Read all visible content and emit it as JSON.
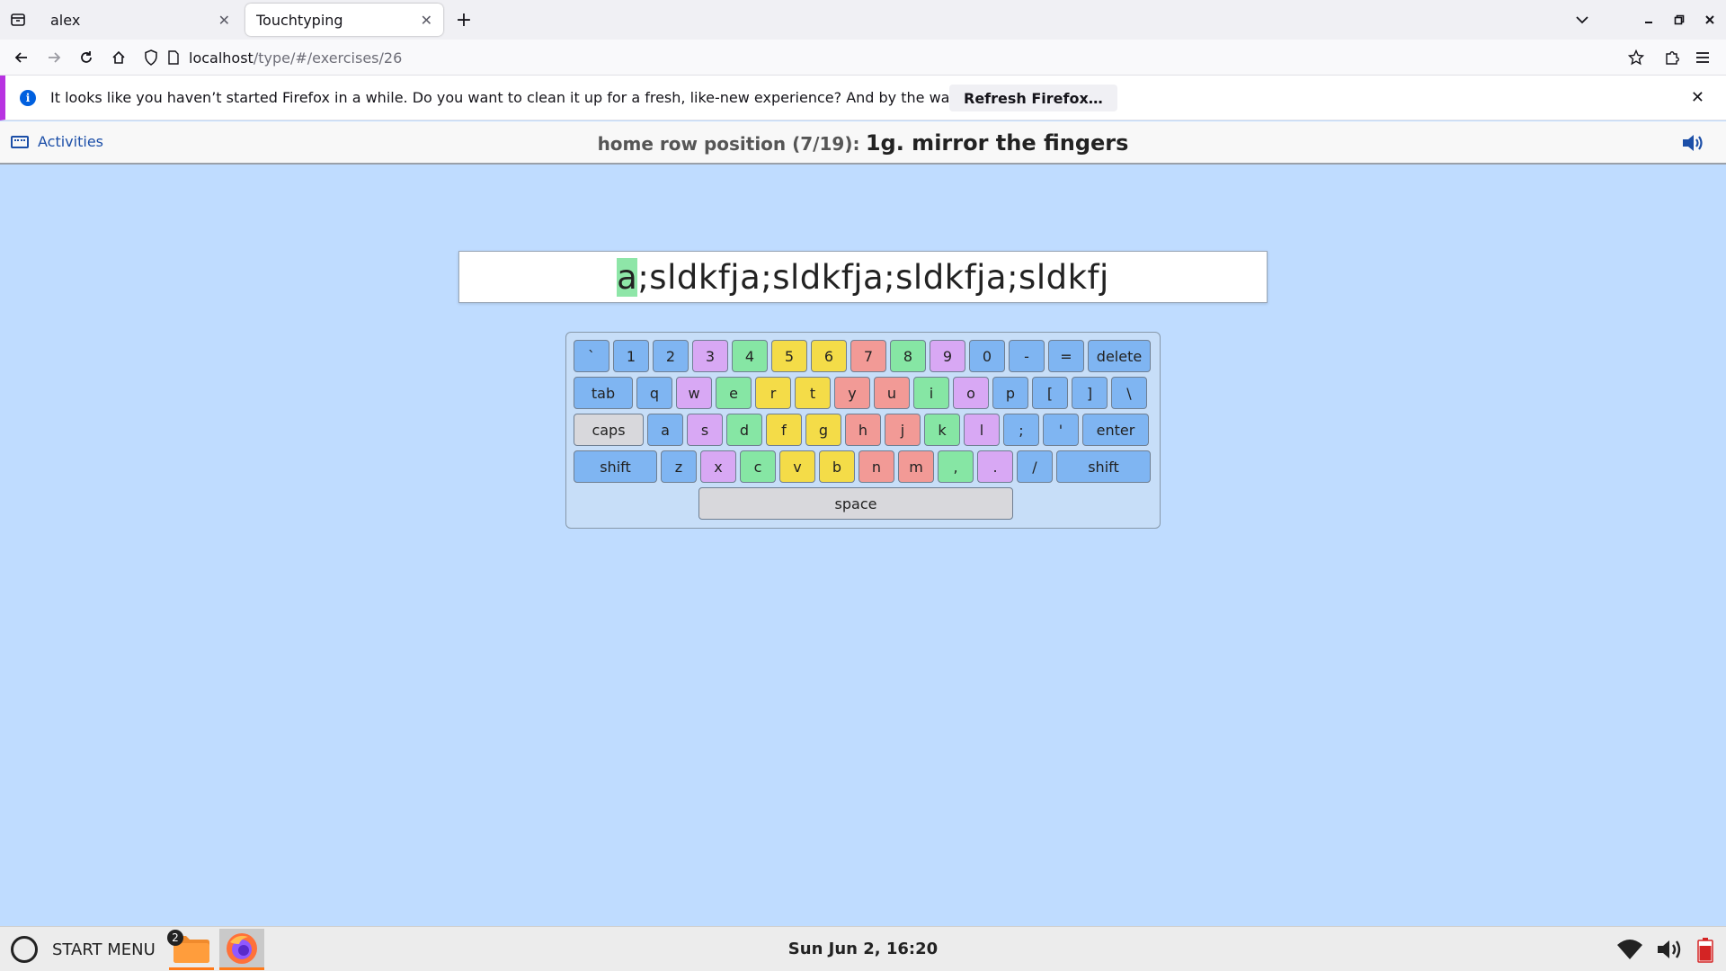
{
  "browser": {
    "tabs": [
      {
        "title": "alex",
        "active": false
      },
      {
        "title": "Touchtyping",
        "active": true
      }
    ],
    "url": {
      "host": "localhost",
      "path": "/type/#/exercises/26"
    },
    "notification": {
      "message": "It looks like you haven’t started Firefox in a while. Do you want to clean it up for a fresh, like-new experience? And by the way, welcome back!",
      "button_label": "Refresh Firefox…"
    }
  },
  "app": {
    "activities_label": "Activities",
    "lesson_prefix": "home row position (7/19):",
    "lesson_name": "1g. mirror the fingers",
    "exercise_text": {
      "current": "a",
      "remaining": ";sldkfja;sldkfja;sldkfja;sldkfj"
    }
  },
  "keyboard": {
    "colors": {
      "blue": "#7fb5f2",
      "purple": "#d8a8f4",
      "green": "#86e6a4",
      "yellow": "#f4dc48",
      "red": "#f29a96",
      "gray": "#d8d8dc"
    },
    "rows": [
      [
        {
          "label": "`",
          "color": "blue"
        },
        {
          "label": "1",
          "color": "blue"
        },
        {
          "label": "2",
          "color": "blue"
        },
        {
          "label": "3",
          "color": "purple"
        },
        {
          "label": "4",
          "color": "green"
        },
        {
          "label": "5",
          "color": "yellow"
        },
        {
          "label": "6",
          "color": "yellow"
        },
        {
          "label": "7",
          "color": "red"
        },
        {
          "label": "8",
          "color": "green"
        },
        {
          "label": "9",
          "color": "purple"
        },
        {
          "label": "0",
          "color": "blue"
        },
        {
          "label": "-",
          "color": "blue"
        },
        {
          "label": "=",
          "color": "blue"
        },
        {
          "label": "delete",
          "color": "blue"
        }
      ],
      [
        {
          "label": "tab",
          "color": "blue"
        },
        {
          "label": "q",
          "color": "blue"
        },
        {
          "label": "w",
          "color": "purple"
        },
        {
          "label": "e",
          "color": "green"
        },
        {
          "label": "r",
          "color": "yellow"
        },
        {
          "label": "t",
          "color": "yellow"
        },
        {
          "label": "y",
          "color": "red"
        },
        {
          "label": "u",
          "color": "red"
        },
        {
          "label": "i",
          "color": "green"
        },
        {
          "label": "o",
          "color": "purple"
        },
        {
          "label": "p",
          "color": "blue"
        },
        {
          "label": "[",
          "color": "blue"
        },
        {
          "label": "]",
          "color": "blue"
        },
        {
          "label": "\\",
          "color": "blue"
        }
      ],
      [
        {
          "label": "caps",
          "color": "gray"
        },
        {
          "label": "a",
          "color": "blue"
        },
        {
          "label": "s",
          "color": "purple"
        },
        {
          "label": "d",
          "color": "green"
        },
        {
          "label": "f",
          "color": "yellow"
        },
        {
          "label": "g",
          "color": "yellow"
        },
        {
          "label": "h",
          "color": "red"
        },
        {
          "label": "j",
          "color": "red"
        },
        {
          "label": "k",
          "color": "green"
        },
        {
          "label": "l",
          "color": "purple"
        },
        {
          "label": ";",
          "color": "blue"
        },
        {
          "label": "'",
          "color": "blue"
        },
        {
          "label": "enter",
          "color": "blue"
        }
      ],
      [
        {
          "label": "shift",
          "color": "blue"
        },
        {
          "label": "z",
          "color": "blue"
        },
        {
          "label": "x",
          "color": "purple"
        },
        {
          "label": "c",
          "color": "green"
        },
        {
          "label": "v",
          "color": "yellow"
        },
        {
          "label": "b",
          "color": "yellow"
        },
        {
          "label": "n",
          "color": "red"
        },
        {
          "label": "m",
          "color": "red"
        },
        {
          "label": ",",
          "color": "green"
        },
        {
          "label": ".",
          "color": "purple"
        },
        {
          "label": "/",
          "color": "blue"
        },
        {
          "label": "shift",
          "color": "blue"
        }
      ],
      [
        {
          "label": "space",
          "color": "gray"
        }
      ]
    ]
  },
  "taskbar": {
    "start_label": "START MENU",
    "folder_badge": "2",
    "clock": "Sun Jun 2,  16:20"
  }
}
